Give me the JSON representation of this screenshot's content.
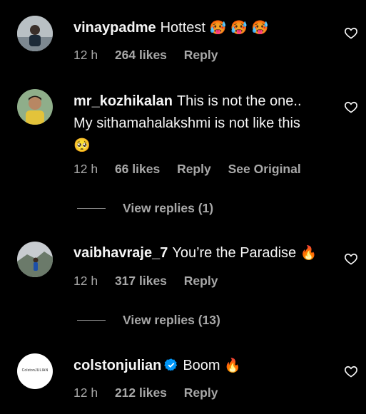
{
  "comments": [
    {
      "username": "vinaypadme",
      "text": "Hottest",
      "emoji": "🥵 🥵 🥵",
      "time": "12 h",
      "likes": "264 likes",
      "reply": "Reply",
      "avatar_icon": "profile-photo"
    },
    {
      "username": "mr_kozhikalan",
      "text_line1": "This is not the one..",
      "text_line2": "My sithamahalakshmi is not like this",
      "emoji": "🥺",
      "time": "12 h",
      "likes": "66 likes",
      "reply": "Reply",
      "see_original": "See Original",
      "view_replies": "View replies (1)",
      "avatar_icon": "profile-photo"
    },
    {
      "username": "vaibhavraje_7",
      "text": "You’re the Paradise",
      "emoji": "🔥",
      "time": "12 h",
      "likes": "317 likes",
      "reply": "Reply",
      "view_replies": "View replies (13)",
      "avatar_icon": "profile-photo"
    },
    {
      "username": "colstonjulian",
      "verified_icon": "verified-badge-icon",
      "text": "Boom",
      "emoji": "🔥",
      "time": "12 h",
      "likes": "212 likes",
      "reply": "Reply",
      "logo_text": "ColstonJULIAN"
    }
  ],
  "colors": {
    "background": "#000000",
    "text": "#f5f5f5",
    "secondary": "#a8a8a8",
    "verified": "#0095f6"
  }
}
